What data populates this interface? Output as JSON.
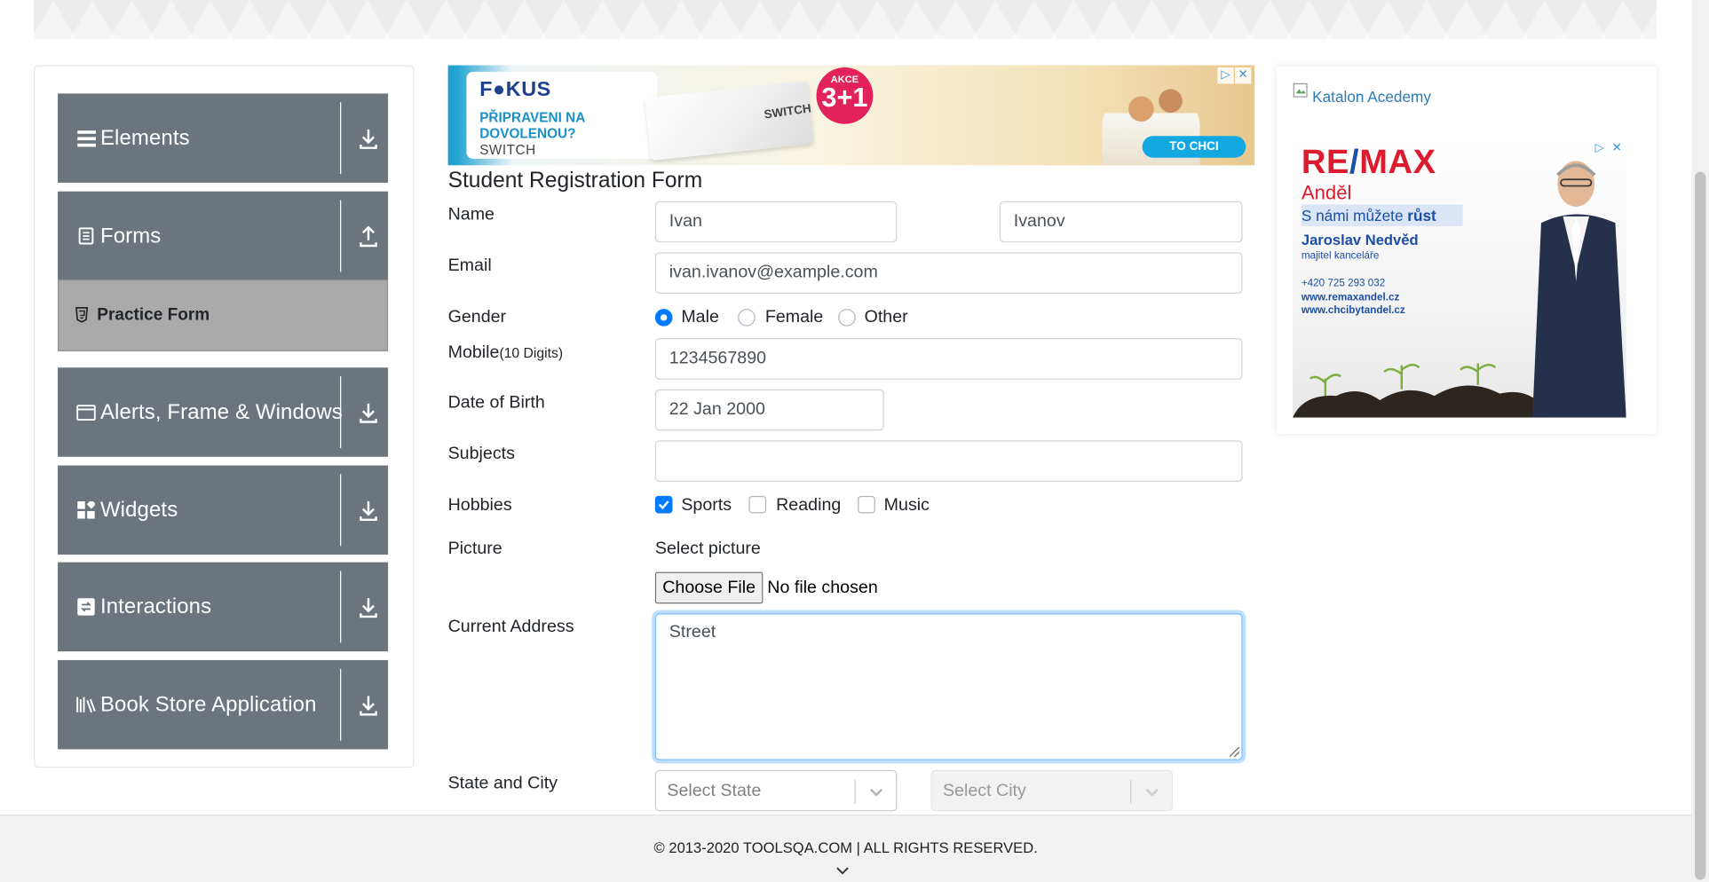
{
  "sidebar": {
    "groups": [
      {
        "label": "Elements",
        "icon": "menu-icon",
        "toggle": "download-icon"
      },
      {
        "label": "Forms",
        "icon": "document-icon",
        "toggle": "upload-icon"
      },
      {
        "label": "Alerts, Frame & Windows",
        "icon": "window-icon",
        "toggle": "download-icon"
      },
      {
        "label": "Widgets",
        "icon": "widgets-icon",
        "toggle": "download-icon"
      },
      {
        "label": "Interactions",
        "icon": "interactions-icon",
        "toggle": "download-icon"
      },
      {
        "label": "Book Store Application",
        "icon": "bookstore-icon",
        "toggle": "download-icon"
      }
    ],
    "active_item": {
      "label": "Practice Form",
      "icon": "html5-icon"
    }
  },
  "ad_top": {
    "brand": "F●KUS",
    "headline": "PŘIPRAVENI NA DOVOLENOU?",
    "product": "SWITCH",
    "pack_label": "SWITCH",
    "badge_small": "AKCE",
    "badge_big": "3+1",
    "cta": "TO CHCI"
  },
  "form": {
    "title": "Student Registration Form",
    "name_label": "Name",
    "first_name": "Ivan",
    "last_name": "Ivanov",
    "email_label": "Email",
    "email": "ivan.ivanov@example.com",
    "gender_label": "Gender",
    "genders": [
      "Male",
      "Female",
      "Other"
    ],
    "gender_selected": "Male",
    "mobile_label": "Mobile",
    "mobile_hint": "(10 Digits)",
    "mobile": "1234567890",
    "dob_label": "Date of Birth",
    "dob": "22 Jan 2000",
    "subjects_label": "Subjects",
    "subjects": "",
    "hobbies_label": "Hobbies",
    "hobbies": [
      {
        "label": "Sports",
        "checked": true
      },
      {
        "label": "Reading",
        "checked": false
      },
      {
        "label": "Music",
        "checked": false
      }
    ],
    "picture_label": "Picture",
    "picture_prompt": "Select picture",
    "choose_file": "Choose File",
    "file_status": "No file chosen",
    "address_label": "Current Address",
    "address": "Street",
    "state_city_label": "State and City",
    "state_placeholder": "Select State",
    "city_placeholder": "Select City"
  },
  "ad_right": {
    "broken_image_alt": "Katalon Acedemy",
    "logo_left": "RE",
    "logo_slash": "/",
    "logo_right": "MAX",
    "office": "Anděl",
    "tagline_start": "S námi můžete ",
    "tagline_bold": "růst",
    "agent_name": "Jaroslav Nedvěd",
    "agent_role": "majitel kanceláře",
    "phone": "+420 725 293 032",
    "web1": "www.remaxandel.cz",
    "web2": "www.chcibytandel.cz"
  },
  "footer": {
    "text": "© 2013-2020 TOOLSQA.COM | ALL RIGHTS RESERVED."
  },
  "colors": {
    "sidebar_group": "#6c757d",
    "sidebar_active": "#aaaaaa",
    "accent": "#007bff",
    "remax_red": "#dc1c2e",
    "remax_blue": "#1c4ea5"
  }
}
